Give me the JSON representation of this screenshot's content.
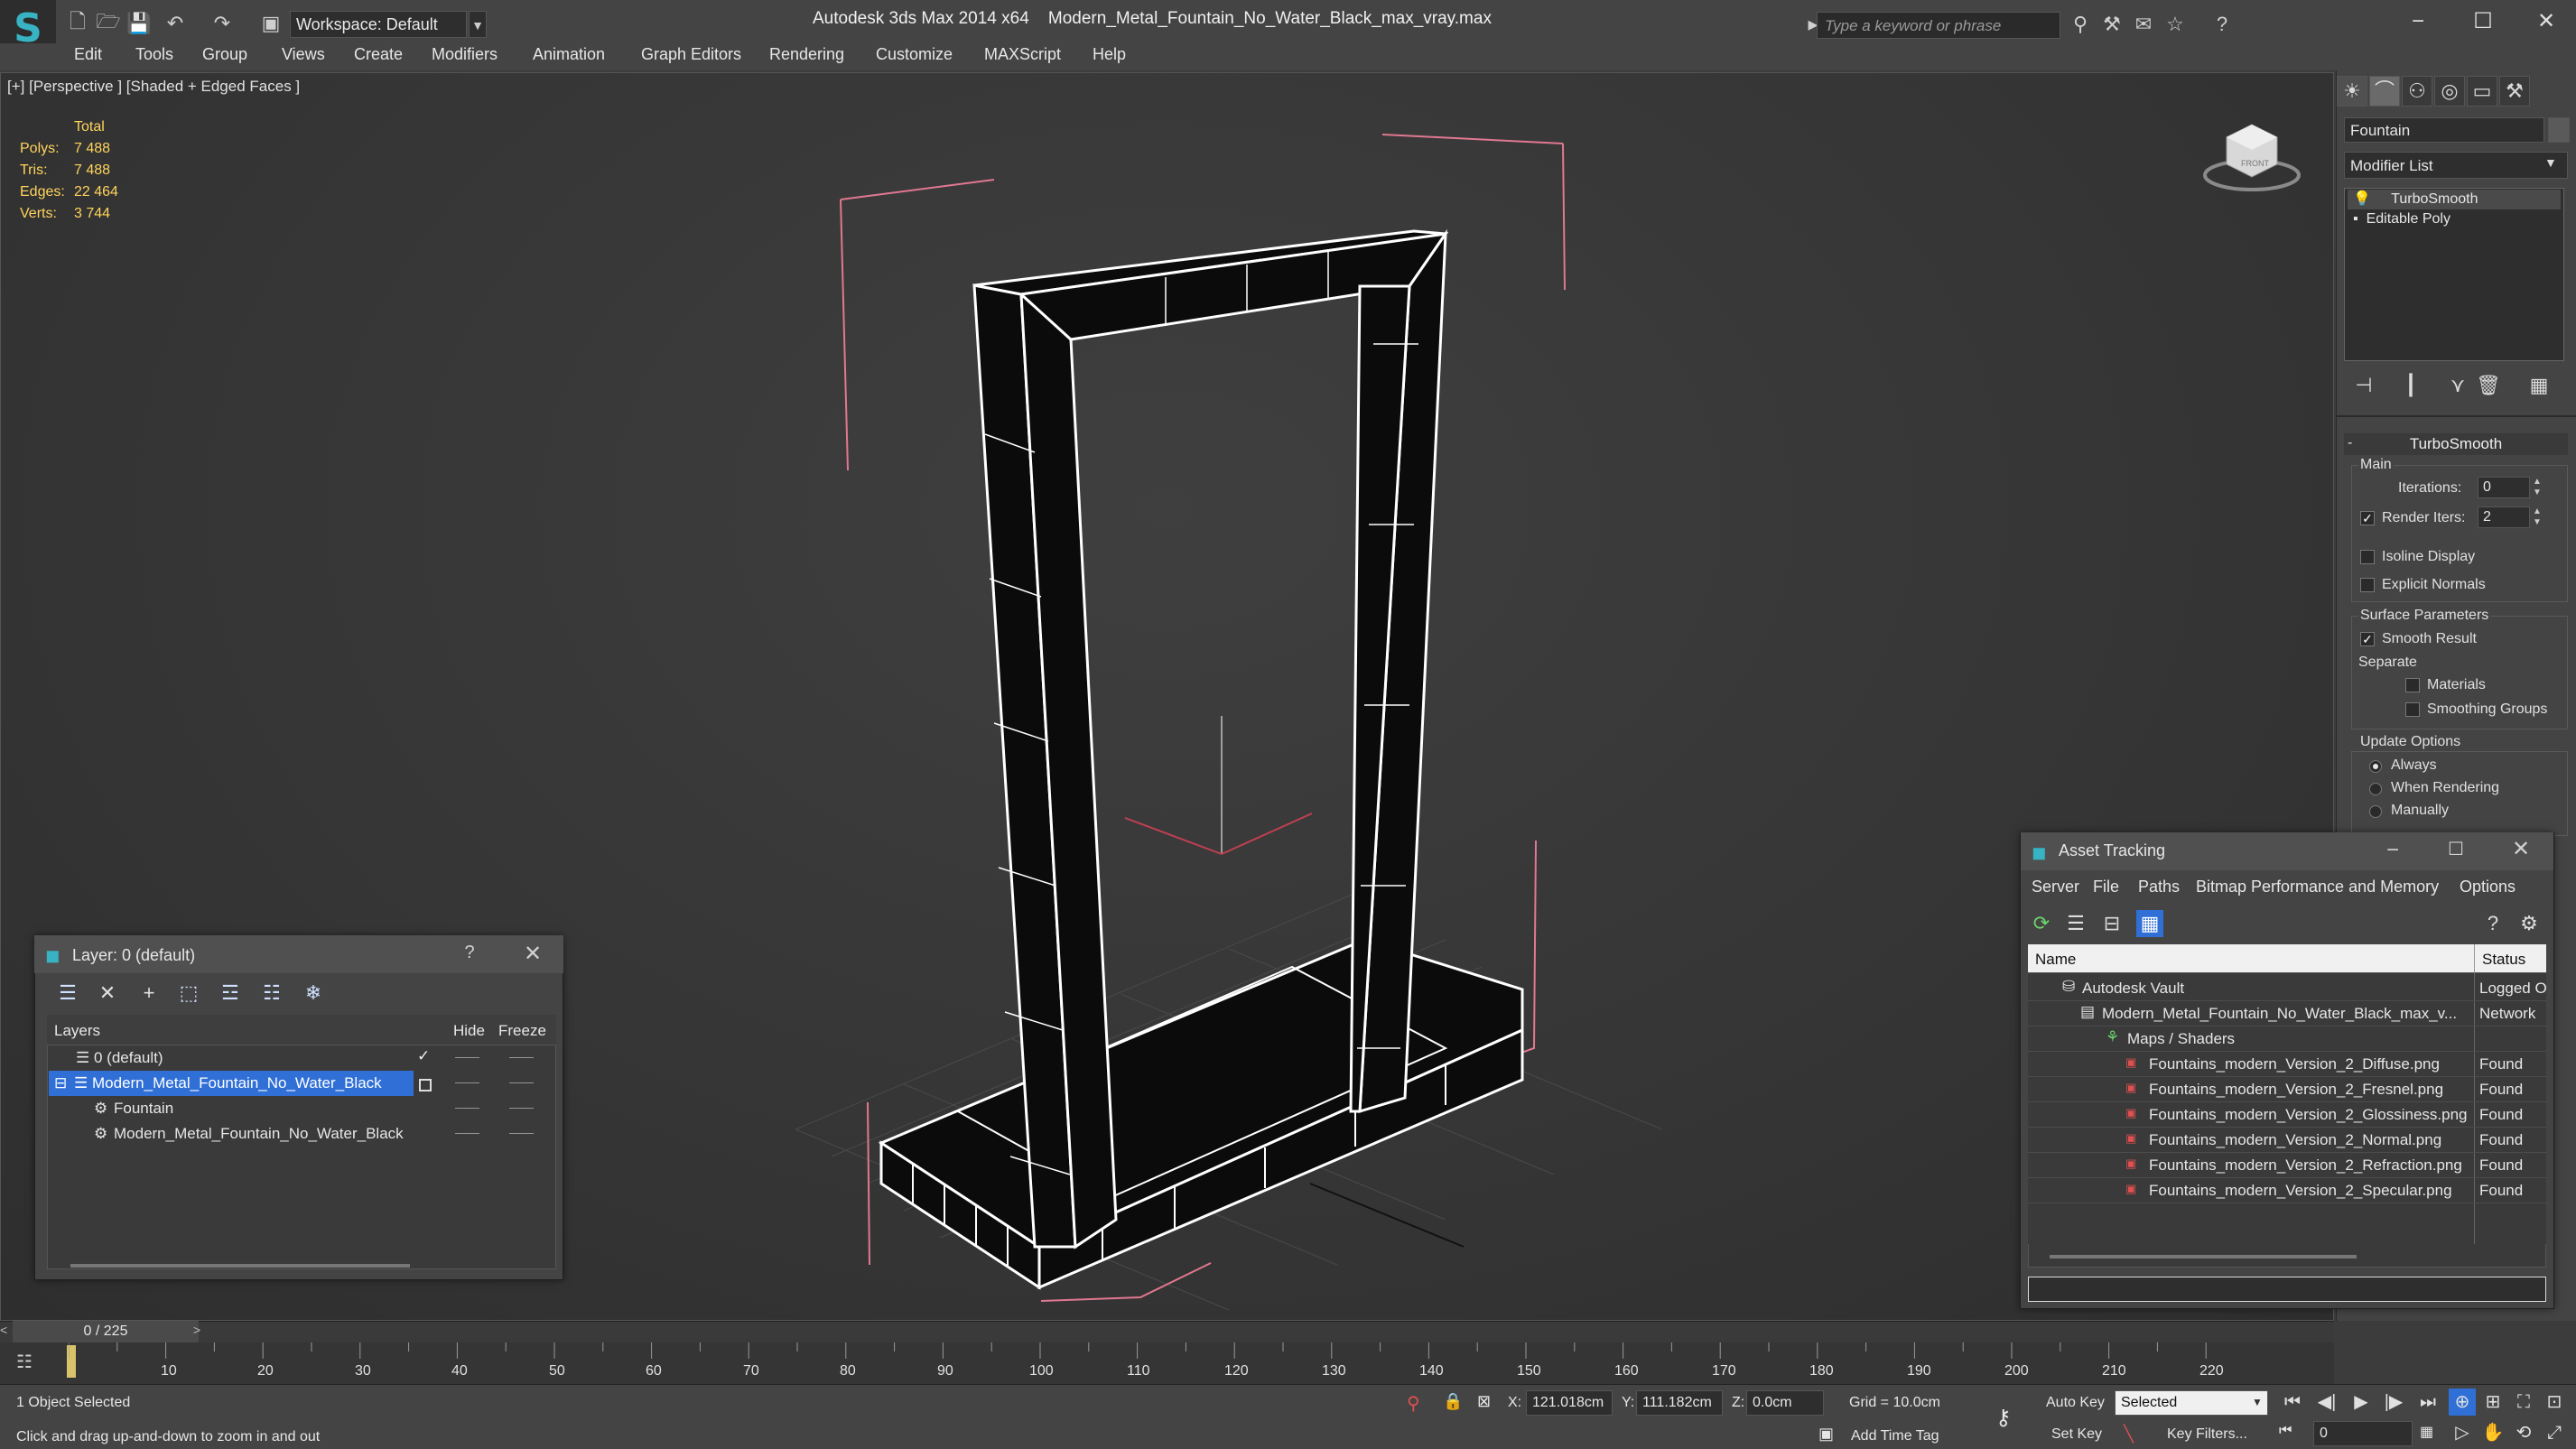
{
  "app": {
    "title_app": "Autodesk 3ds Max  2014 x64",
    "title_file": "Modern_Metal_Fountain_No_Water_Black_max_vray.max",
    "workspace": "Workspace: Default",
    "search_placeholder": "Type a keyword or phrase"
  },
  "menu": [
    "Edit",
    "Tools",
    "Group",
    "Views",
    "Create",
    "Modifiers",
    "Animation",
    "Graph Editors",
    "Rendering",
    "Customize",
    "MAXScript",
    "Help"
  ],
  "viewport": {
    "label": "[+] [Perspective ] [Shaded + Edged Faces ]",
    "stats_header": "Total",
    "stats": [
      {
        "k": "Polys:",
        "v": "7 488"
      },
      {
        "k": "Tris:",
        "v": "7 488"
      },
      {
        "k": "Edges:",
        "v": "22 464"
      },
      {
        "k": "Verts:",
        "v": "3 744"
      }
    ],
    "viewcube_label": "FRONT"
  },
  "command_panel": {
    "object_name": "Fountain",
    "modifier_list": "Modifier List",
    "stack": [
      "TurboSmooth",
      "Editable Poly"
    ],
    "rollout_title": "TurboSmooth",
    "main_label": "Main",
    "iterations_label": "Iterations:",
    "iterations_value": "0",
    "render_iters_label": "Render Iters:",
    "render_iters_value": "2",
    "render_iters_checked": true,
    "isoline_label": "Isoline Display",
    "explicit_label": "Explicit Normals",
    "surface_label": "Surface Parameters",
    "smooth_label": "Smooth Result",
    "separate_label": "Separate",
    "materials_label": "Materials",
    "smoothing_label": "Smoothing Groups",
    "update_label": "Update Options",
    "always_label": "Always",
    "when_label": "When Rendering",
    "manually_label": "Manually"
  },
  "layer_dialog": {
    "title": "Layer: 0 (default)",
    "col_layers": "Layers",
    "col_hide": "Hide",
    "col_freeze": "Freeze",
    "rows": [
      "0 (default)",
      "Modern_Metal_Fountain_No_Water_Black",
      "Fountain",
      "Modern_Metal_Fountain_No_Water_Black"
    ]
  },
  "asset_dialog": {
    "title": "Asset Tracking",
    "menu": [
      "Server",
      "File",
      "Paths",
      "Bitmap Performance and Memory",
      "Options"
    ],
    "col_name": "Name",
    "col_status": "Status",
    "rows": [
      {
        "name": "Autodesk Vault",
        "status": "Logged O"
      },
      {
        "name": "Modern_Metal_Fountain_No_Water_Black_max_v...",
        "status": "Network"
      },
      {
        "name": "Maps / Shaders",
        "status": ""
      },
      {
        "name": "Fountains_modern_Version_2_Diffuse.png",
        "status": "Found"
      },
      {
        "name": "Fountains_modern_Version_2_Fresnel.png",
        "status": "Found"
      },
      {
        "name": "Fountains_modern_Version_2_Glossiness.png",
        "status": "Found"
      },
      {
        "name": "Fountains_modern_Version_2_Normal.png",
        "status": "Found"
      },
      {
        "name": "Fountains_modern_Version_2_Refraction.png",
        "status": "Found"
      },
      {
        "name": "Fountains_modern_Version_2_Specular.png",
        "status": "Found"
      }
    ]
  },
  "timeline": {
    "frame": "0 / 225",
    "ticks": [
      "10",
      "20",
      "30",
      "40",
      "50",
      "60",
      "70",
      "80",
      "90",
      "100",
      "110",
      "120",
      "130",
      "140",
      "150",
      "160",
      "170",
      "180",
      "190",
      "200",
      "210",
      "220"
    ]
  },
  "status": {
    "selected": "1 Object Selected",
    "prompt": "Click and drag up-and-down to zoom in and out",
    "x_label": "X:",
    "x_value": "121.018cm",
    "y_label": "Y:",
    "y_value": "111.182cm",
    "z_label": "Z:",
    "z_value": "0.0cm",
    "grid": "Grid = 10.0cm",
    "add_time_tag": "Add Time Tag",
    "auto_key": "Auto Key",
    "set_key": "Set Key",
    "selected_dd": "Selected",
    "key_filters": "Key Filters...",
    "frame_field": "0"
  }
}
